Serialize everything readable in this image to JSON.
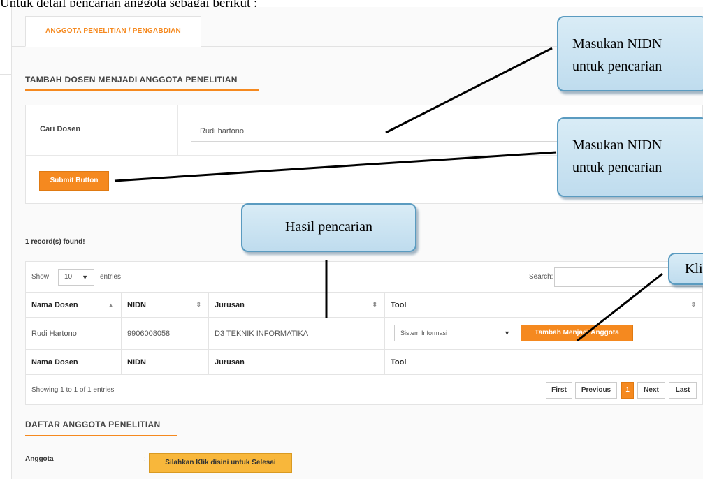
{
  "caption": "Untuk detail pencarian anggota sebagai berikut :",
  "tab": {
    "label": "ANGGOTA PENELITIAN / PENGABDIAN"
  },
  "add_section": {
    "title": "TAMBAH DOSEN MENJADI ANGGOTA PENELITIAN"
  },
  "search_form": {
    "label": "Cari Dosen",
    "value": "Rudi hartono",
    "submit_label": "Submit Button"
  },
  "records_found": "1 record(s) found!",
  "table": {
    "show_label": "Show",
    "entries_value": "10",
    "entries_label": "entries",
    "search_label": "Search:",
    "columns": [
      "Nama Dosen",
      "NIDN",
      "Jurusan",
      "Tool"
    ],
    "rows": [
      {
        "nama": "Rudi Hartono",
        "nidn": "9906008058",
        "jurusan": "D3 TEKNIK INFORMATIKA",
        "tool_select": "Sistem Informasi",
        "tool_button": "Tambah Menjadi Anggota"
      }
    ],
    "showing": "Showing 1 to 1 of 1 entries",
    "pagination": {
      "first": "First",
      "previous": "Previous",
      "current": "1",
      "next": "Next",
      "last": "Last"
    }
  },
  "list_section": {
    "title": "DAFTAR ANGGOTA PENELITIAN",
    "anggota_label": "Anggota",
    "colon": ":",
    "finish_button": "Silahkan Klik disini untuk Selesai"
  },
  "callouts": {
    "c1_line1": "Masukan NIDN",
    "c1_line2": "untuk pencarian",
    "c2_line1": "Masukan NIDN",
    "c2_line2": "untuk pencarian",
    "c3": "Hasil pencarian",
    "c4": "Klik"
  },
  "colors": {
    "accent": "#f5891f",
    "finish_button": "#f8b73b",
    "callout_border": "#5a9bc0"
  }
}
